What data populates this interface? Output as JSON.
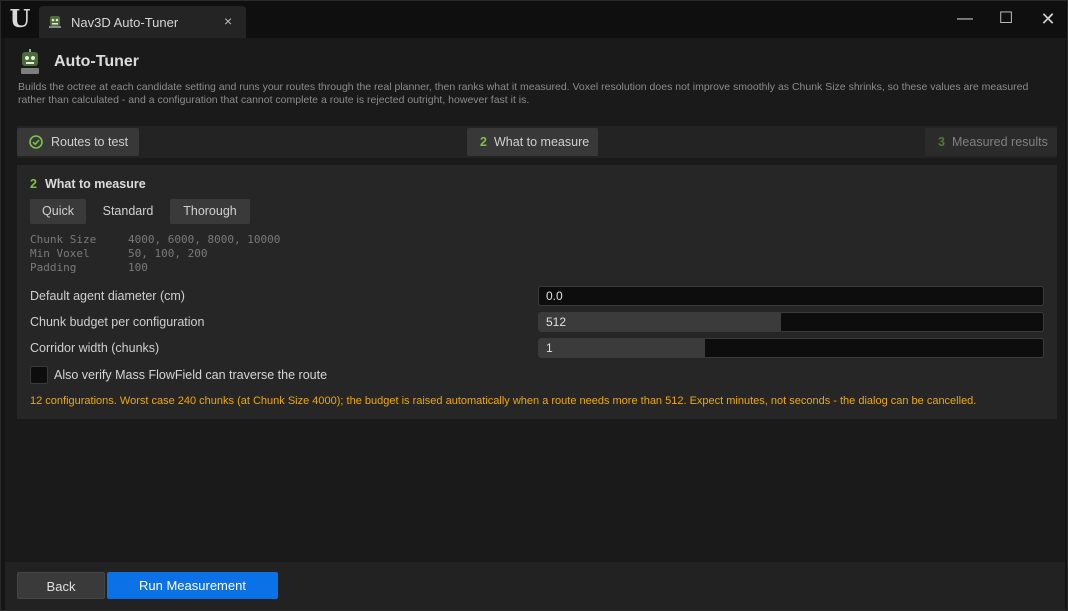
{
  "window": {
    "tab_title": "Nav3D Auto-Tuner",
    "tab_close": "×",
    "minimize": "—",
    "maximize": "☐",
    "close": "✕"
  },
  "header": {
    "title": "Auto-Tuner",
    "description": "Builds the octree at each candidate setting and runs your routes through the real planner, then ranks what it measured. Voxel resolution does not improve smoothly as Chunk Size shrinks, so these values are measured rather than calculated - and a configuration that cannot complete a route is rejected outright, however fast it is."
  },
  "steps": [
    {
      "label": "Routes to test",
      "state": "done"
    },
    {
      "num": "2",
      "label": "What to measure",
      "state": "active"
    },
    {
      "num": "3",
      "label": "Measured results",
      "state": "pending"
    }
  ],
  "panel": {
    "num": "2",
    "title": "What to measure",
    "presets": [
      "Quick",
      "Standard",
      "Thorough"
    ],
    "selected_preset": "Standard",
    "settings": [
      {
        "key": "Chunk Size",
        "value": "4000, 6000, 8000, 10000"
      },
      {
        "key": "Min Voxel",
        "value": "50, 100, 200"
      },
      {
        "key": "Padding",
        "value": "100"
      }
    ],
    "fields": {
      "agent": {
        "label": "Default agent diameter (cm)",
        "value": "0.0"
      },
      "budget": {
        "label": "Chunk budget per configuration",
        "value": "512",
        "fill": 0.48
      },
      "corridor": {
        "label": "Corridor width (chunks)",
        "value": "1",
        "fill": 0.33
      }
    },
    "verify": {
      "label": "Also verify Mass FlowField can traverse the route",
      "checked": false
    },
    "warning": "12 configurations. Worst case 240 chunks (at Chunk Size 4000); the budget is raised automatically when a route needs more than 512. Expect minutes, not seconds - the dialog can be cancelled."
  },
  "footer": {
    "back": "Back",
    "run": "Run Measurement"
  },
  "colors": {
    "accent_green": "#7cc24a",
    "warning": "#f0a800",
    "primary_button": "#0a72e6"
  }
}
